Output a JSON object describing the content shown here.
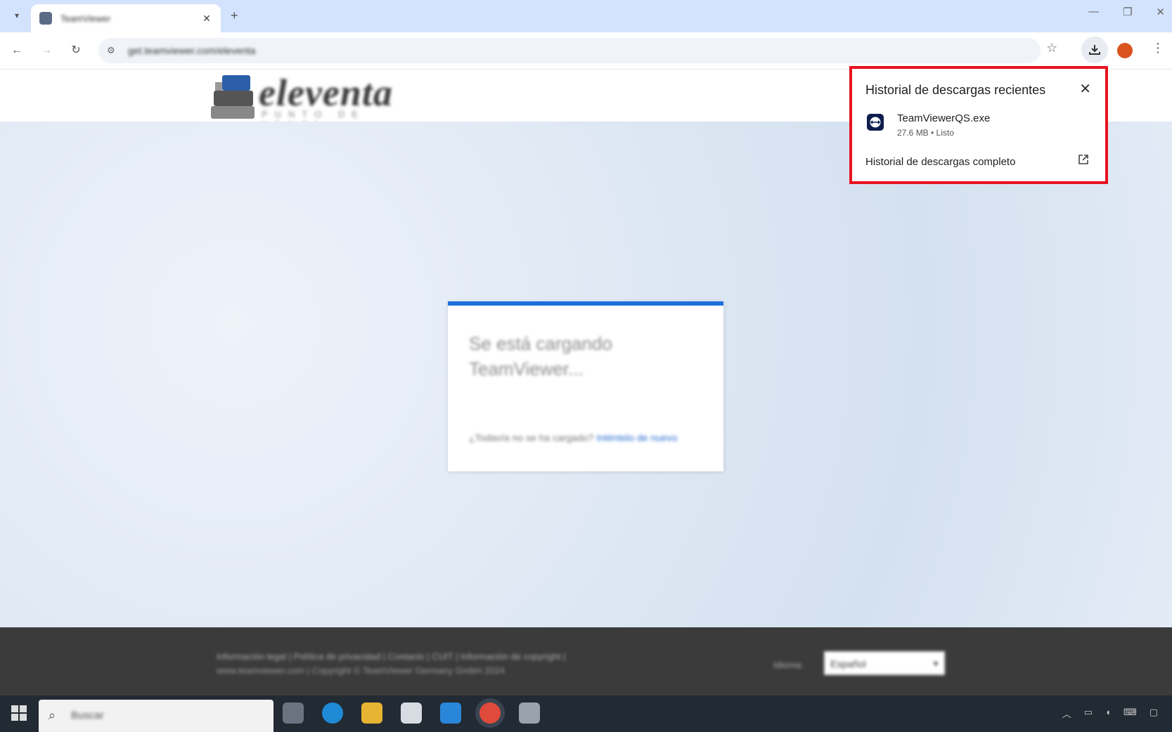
{
  "browser": {
    "tab_title": "TeamViewer",
    "url": "get.teamviewer.com/eleventa",
    "new_tab_label": "+",
    "tab_close_label": "✕"
  },
  "site": {
    "logo_name": "eleventa",
    "logo_tagline": "PUNTO DE VENTA"
  },
  "loading": {
    "title": "Se está cargando TeamViewer...",
    "help_text": "¿Todavía no se ha cargado?",
    "help_link": "Inténtelo de nuevo"
  },
  "footer": {
    "links": "Información legal | Política de privacidad | Contacto | CUIT | Información de copyright |",
    "copyright": "www.teamviewer.com | Copyright © TeamViewer Germany GmbH 2024",
    "language_label": "Idioma:",
    "language_value": "Español"
  },
  "taskbar": {
    "search_placeholder": "Buscar"
  },
  "downloads": {
    "title": "Historial de descargas recientes",
    "close_label": "✕",
    "items": [
      {
        "name": "TeamViewerQS.exe",
        "meta": "27.6 MB • Listo"
      }
    ],
    "full_history_label": "Historial de descargas completo"
  },
  "colors": {
    "highlight": "#e8121f",
    "accent": "#1e6fdc",
    "tabstrip": "#d3e3fd",
    "footer": "#3b3b3b",
    "taskbar": "#222a33"
  }
}
